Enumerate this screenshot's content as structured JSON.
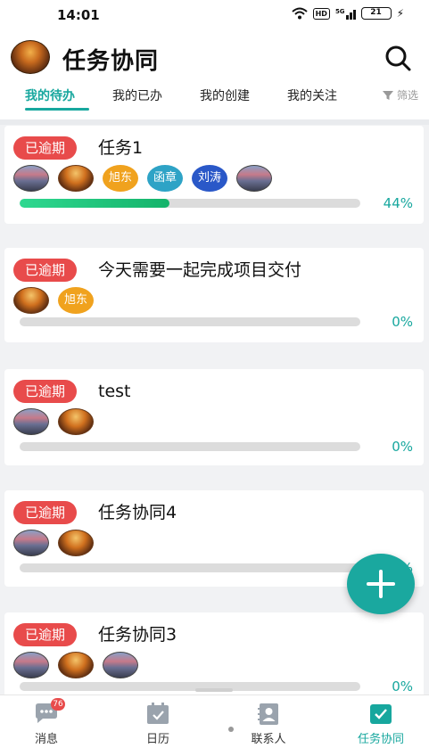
{
  "status_bar": {
    "time": "14:01",
    "hd": "HD",
    "network": "5G",
    "battery": "21"
  },
  "header": {
    "title": "任务协同"
  },
  "tabs": [
    {
      "label": "我的待办",
      "active": true
    },
    {
      "label": "我的已办",
      "active": false
    },
    {
      "label": "我的创建",
      "active": false
    },
    {
      "label": "我的关注",
      "active": false
    }
  ],
  "filter_label": "筛选",
  "tasks": [
    {
      "status": "已逾期",
      "title": "任务1",
      "progress": 44,
      "progress_label": "44%",
      "members": [
        "photo-b",
        "photo-a",
        "旭东",
        "函章",
        "刘涛",
        "photo-b"
      ]
    },
    {
      "status": "已逾期",
      "title": "今天需要一起完成项目交付",
      "progress": 0,
      "progress_label": "0%",
      "members": [
        "photo-a",
        "旭东"
      ]
    },
    {
      "status": "已逾期",
      "title": "test",
      "progress": 0,
      "progress_label": "0%",
      "members": [
        "photo-b",
        "photo-a"
      ]
    },
    {
      "status": "已逾期",
      "title": "任务协同4",
      "progress": 0,
      "progress_label": "0%",
      "members": [
        "photo-b",
        "photo-a"
      ]
    },
    {
      "status": "已逾期",
      "title": "任务协同3",
      "progress": 0,
      "progress_label": "0%",
      "members": [
        "photo-b",
        "photo-a",
        "photo-b"
      ]
    }
  ],
  "bottom_nav": [
    {
      "label": "消息",
      "badge": "76",
      "icon": "chat-icon",
      "active": false
    },
    {
      "label": "日历",
      "icon": "calendar-icon",
      "active": false
    },
    {
      "label": "联系人",
      "icon": "contacts-icon",
      "active": false
    },
    {
      "label": "任务协同",
      "icon": "task-icon",
      "active": true
    }
  ],
  "colors": {
    "accent": "#17a79e",
    "overdue": "#e84b4b",
    "progress": "#14b36a"
  }
}
